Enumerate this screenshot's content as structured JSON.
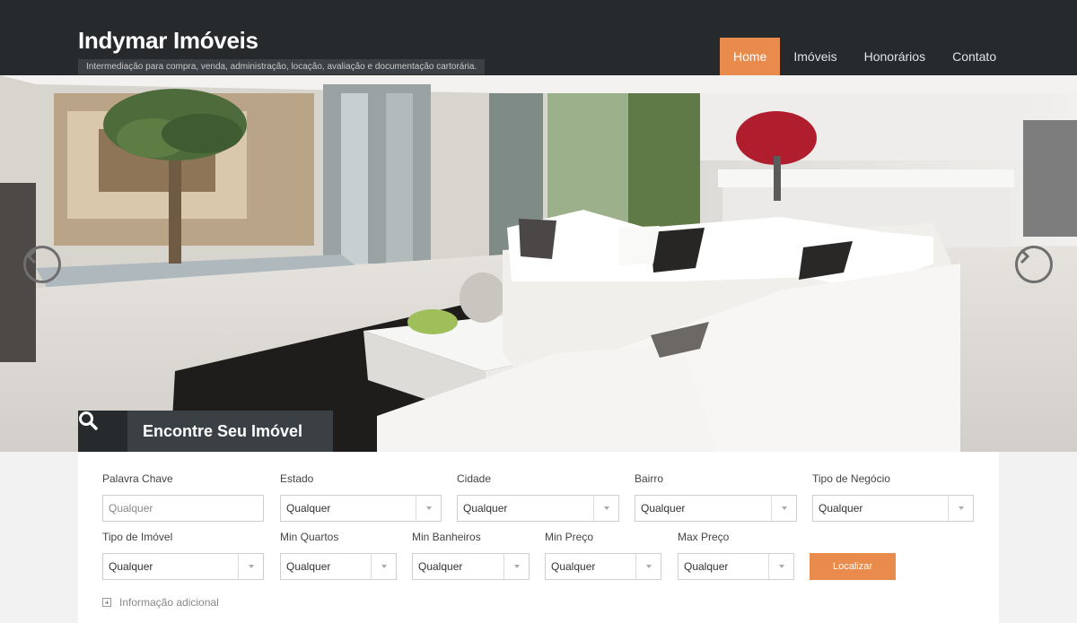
{
  "site": {
    "title": "Indymar Imóveis",
    "tagline": "Intermediação para compra, venda, administração, locação, avaliação e documentação cartorária."
  },
  "nav": {
    "items": [
      {
        "label": "Home",
        "active": true
      },
      {
        "label": "Imóveis",
        "active": false
      },
      {
        "label": "Honorários",
        "active": false
      },
      {
        "label": "Contato",
        "active": false
      }
    ]
  },
  "hero": {
    "prev_icon": "chevron-left-icon",
    "next_icon": "chevron-right-icon"
  },
  "search": {
    "title": "Encontre Seu Imóvel",
    "icon": "search-icon",
    "keyword": {
      "label": "Palavra Chave",
      "placeholder": "Qualquer"
    },
    "estado": {
      "label": "Estado",
      "value": "Qualquer"
    },
    "cidade": {
      "label": "Cidade",
      "value": "Qualquer"
    },
    "bairro": {
      "label": "Bairro",
      "value": "Qualquer"
    },
    "tipo_negocio": {
      "label": "Tipo de Negócio",
      "value": "Qualquer"
    },
    "tipo_imovel": {
      "label": "Tipo de Imóvel",
      "value": "Qualquer"
    },
    "min_quartos": {
      "label": "Min Quartos",
      "value": "Qualquer"
    },
    "min_banheiros": {
      "label": "Min Banheiros",
      "value": "Qualquer"
    },
    "min_preco": {
      "label": "Min Preço",
      "value": "Qualquer"
    },
    "max_preco": {
      "label": "Max Preço",
      "value": "Qualquer"
    },
    "submit_label": "Localizar",
    "more_info_label": "Informação adicional"
  },
  "colors": {
    "header_bg": "#262a2c",
    "accent": "#e98b4c"
  }
}
